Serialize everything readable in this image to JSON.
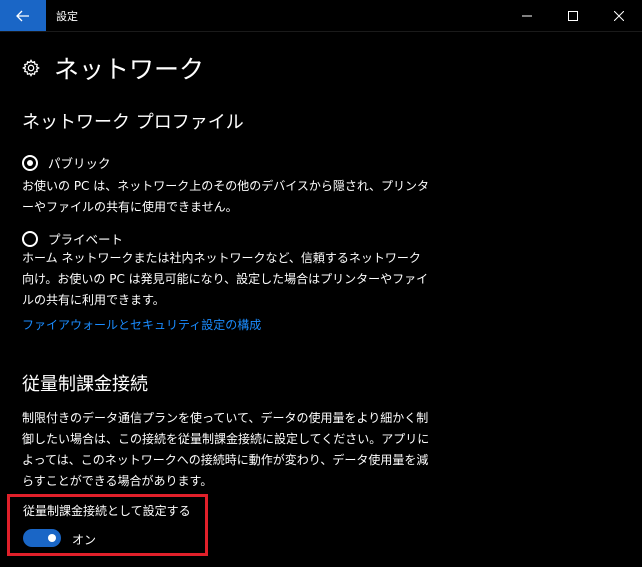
{
  "titlebar": {
    "title": "設定",
    "back_icon": "arrow-left-icon",
    "minimize_icon": "minimize-icon",
    "maximize_icon": "maximize-icon",
    "close_icon": "close-icon"
  },
  "header": {
    "icon": "gear-icon",
    "title": "ネットワーク"
  },
  "profile": {
    "section_title": "ネットワーク プロファイル",
    "options": [
      {
        "label": "パブリック",
        "checked": true,
        "description": "お使いの PC は、ネットワーク上のその他のデバイスから隠され、プリンターやファイルの共有に使用できません。"
      },
      {
        "label": "プライベート",
        "checked": false,
        "description": "ホーム ネットワークまたは社内ネットワークなど、信頼するネットワーク向け。お使いの PC は発見可能になり、設定した場合はプリンターやファイルの共有に利用できます。"
      }
    ],
    "firewall_link": "ファイアウォールとセキュリティ設定の構成"
  },
  "metered": {
    "section_title": "従量制課金接続",
    "description": "制限付きのデータ通信プランを使っていて、データの使用量をより細かく制御したい場合は、この接続を従量制課金接続に設定してください。アプリによっては、このネットワークへの接続時に動作が変わり、データ使用量を減らすことができる場合があります。",
    "toggle_label": "従量制課金接続として設定する",
    "toggle_state": "オン",
    "toggle_on": true
  },
  "colors": {
    "accent": "#1a66c6",
    "link": "#1a8cff",
    "highlight": "#e0202a",
    "background": "#000000"
  }
}
